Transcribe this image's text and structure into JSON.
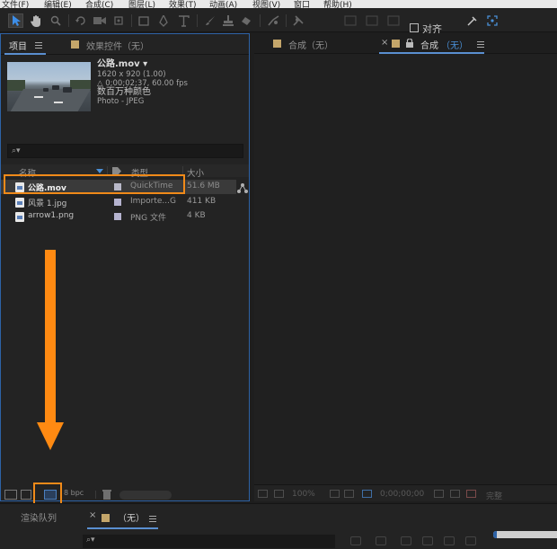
{
  "menu": {
    "file": "文件(F)",
    "edit": "编辑(E)",
    "composition": "合成(C)",
    "layer": "图层(L)",
    "effect": "效果(T)",
    "animation": "动画(A)",
    "view": "视图(V)",
    "window": "窗口",
    "help": "帮助(H)"
  },
  "toolbar": {
    "align_label": "对齐"
  },
  "project_panel": {
    "tab_project": "项目",
    "tab_effects": "效果控件（无）",
    "selected_item": {
      "name": "公路.mov ▾",
      "dimensions": "1620 x 920 (1.00)",
      "duration": "△ 0;00;02;37, 60.00 fps",
      "colors": "数百万种颜色",
      "codec": "Photo - JPEG"
    },
    "search_icon": "⌕▾",
    "columns": {
      "name": "名称",
      "type": "类型",
      "size": "大小"
    },
    "items": [
      {
        "name": "公路.mov",
        "type": "QuickTime",
        "size": "51.6 MB",
        "label_color": "#b9b9c9"
      },
      {
        "name": "风景 1.jpg",
        "type": "Importe...G",
        "size": "411 KB",
        "label_color": "#b5b3cf"
      },
      {
        "name": "arrow1.png",
        "type": "PNG 文件",
        "size": "4 KB",
        "label_color": "#b5b3cf"
      }
    ],
    "bpc": "8 bpc"
  },
  "comp_panel": {
    "tab_comp1": "合成（无）",
    "tab_close": "×",
    "tab_comp2_prefix": "合成",
    "tab_comp2_accent": "（无）",
    "lock_icon": "🔒",
    "viewer_bar": {
      "zoom": "100%",
      "timecode": "0;00;00;00",
      "quality": "完整"
    }
  },
  "timeline_panel": {
    "render_queue": "渲染队列",
    "close": "×",
    "comp_tab": "（无）",
    "search_icon": "⌕▾"
  },
  "colors": {
    "highlight_orange": "#f08a19",
    "arrow_orange": "#ff8a12",
    "accent_blue": "#5a8fd0",
    "comp_swatch": "#c4a66a"
  },
  "annotations": {
    "arrow_direction": "down"
  }
}
